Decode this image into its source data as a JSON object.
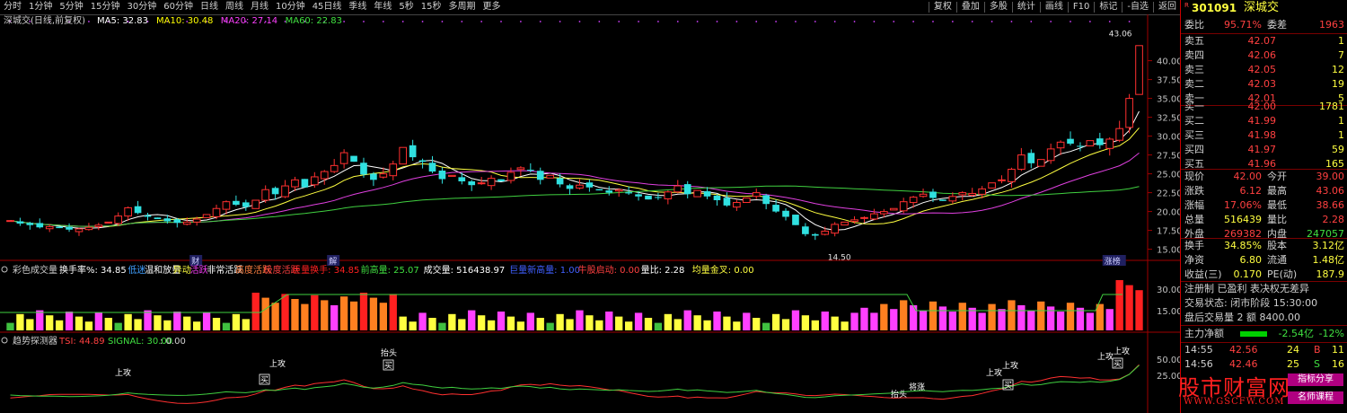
{
  "toolbar": {
    "periods": [
      "分时",
      "1分钟",
      "5分钟",
      "15分钟",
      "30分钟",
      "60分钟",
      "日线",
      "周线",
      "月线",
      "10分钟",
      "45日线",
      "季线",
      "年线",
      "5秒",
      "15秒",
      "多周期",
      "更多"
    ],
    "actions": [
      "复权",
      "叠加",
      "多股",
      "统计",
      "画线",
      "F10",
      "标记",
      "-自选",
      "返回"
    ]
  },
  "main_chart": {
    "title": "深城交(日线,前复权)",
    "ma": [
      {
        "label": "MA5: 32.83",
        "color": "#ffffff"
      },
      {
        "label": "MA10: 30.48",
        "color": "#ffff00"
      },
      {
        "label": "MA20: 27.14",
        "color": "#ff40ff"
      },
      {
        "label": "MA60: 22.83",
        "color": "#40e040"
      }
    ],
    "y_ticks": [
      "40.00",
      "37.50",
      "35.00",
      "32.50",
      "30.00",
      "27.50",
      "25.00",
      "22.50",
      "20.00",
      "17.50",
      "15.00"
    ],
    "high_label": "43.06",
    "low_label": "14.50",
    "event_labels": [
      "财",
      "解",
      "涨榜"
    ]
  },
  "volume_panel": {
    "title": "彩色成交量",
    "items": [
      {
        "label": "换手率%: 34.85",
        "color": "#ffffff"
      },
      {
        "label": "低迷",
        "color": "#40a0ff"
      },
      {
        "label": "温和放量",
        "color": "#ffffff"
      },
      {
        "label": "异动",
        "color": "#ffff40"
      },
      {
        "label": "活跃",
        "color": "#ff40ff"
      },
      {
        "label": "非常活跃",
        "color": "#ffffff"
      },
      {
        "label": "高度活跃",
        "color": "#ff8040"
      },
      {
        "label": "极度活跃",
        "color": "#ff4040"
      },
      {
        "label": "巨量换手: 34.85",
        "color": "#ff2020"
      },
      {
        "label": "前高量: 25.07",
        "color": "#40e040"
      },
      {
        "label": "成交量: 516438.97",
        "color": "#ffffff"
      },
      {
        "label": "巨量新高量: 1.00",
        "color": "#4060ff"
      },
      {
        "label": "牛股启动: 0.00",
        "color": "#ff4040"
      },
      {
        "label": "量比: 2.28",
        "color": "#ffffff"
      },
      {
        "label": "均量金叉: 0.00",
        "color": "#ffff40"
      }
    ],
    "y_ticks": [
      "30.00",
      "15.00"
    ]
  },
  "trend_panel": {
    "title": "趋势探测器",
    "tsi": "TSI: 44.89",
    "signal": "SIGNAL: 30.00",
    "extra": ": 0.00",
    "y_ticks": [
      "50.00",
      "25.00"
    ],
    "signals": [
      "上攻",
      "上攻",
      "抬头",
      "买",
      "买",
      "抬头",
      "将涨",
      "上攻",
      "上攻",
      "买",
      "上攻",
      "买",
      "上攻"
    ]
  },
  "quote": {
    "code": "301091",
    "name": "深城交",
    "weibi_label": "委比",
    "weibi": "95.71%",
    "weicha_label": "委差",
    "weicha": "1963",
    "asks": [
      {
        "label": "卖五",
        "price": "42.07",
        "vol": "1"
      },
      {
        "label": "卖四",
        "price": "42.06",
        "vol": "7"
      },
      {
        "label": "卖三",
        "price": "42.05",
        "vol": "12"
      },
      {
        "label": "卖二",
        "price": "42.03",
        "vol": "19"
      },
      {
        "label": "卖一",
        "price": "42.01",
        "vol": "5"
      }
    ],
    "bids": [
      {
        "label": "买一",
        "price": "42.00",
        "vol": "1781"
      },
      {
        "label": "买二",
        "price": "41.99",
        "vol": "1"
      },
      {
        "label": "买三",
        "price": "41.98",
        "vol": "1"
      },
      {
        "label": "买四",
        "price": "41.97",
        "vol": "59"
      },
      {
        "label": "买五",
        "price": "41.96",
        "vol": "165"
      }
    ],
    "stats": [
      {
        "l1": "现价",
        "v1": "42.00",
        "c1": "red",
        "l2": "今开",
        "v2": "39.00",
        "c2": "red"
      },
      {
        "l1": "涨跌",
        "v1": "6.12",
        "c1": "red",
        "l2": "最高",
        "v2": "43.06",
        "c2": "red"
      },
      {
        "l1": "涨幅",
        "v1": "17.06%",
        "c1": "red",
        "l2": "最低",
        "v2": "38.66",
        "c2": "red"
      },
      {
        "l1": "总量",
        "v1": "516439",
        "c1": "yellow",
        "l2": "量比",
        "v2": "2.28",
        "c2": "red"
      },
      {
        "l1": "外盘",
        "v1": "269382",
        "c1": "red",
        "l2": "内盘",
        "v2": "247057",
        "c2": "green"
      }
    ],
    "stats2": [
      {
        "l1": "换手",
        "v1": "34.85%",
        "c1": "yellow",
        "l2": "股本",
        "v2": "3.12亿",
        "c2": "yellow"
      },
      {
        "l1": "净资",
        "v1": "6.80",
        "c1": "yellow",
        "l2": "流通",
        "v2": "1.48亿",
        "c2": "yellow"
      },
      {
        "l1": "收益(三)",
        "v1": "0.170",
        "c1": "yellow",
        "l2": "PE(动)",
        "v2": "187.9",
        "c2": "yellow"
      }
    ],
    "notes": [
      "注册制 已盈利 表决权无差异",
      "交易状态: 闭市阶段 15:30:00",
      "盘后交易量 2 额 8400.00"
    ],
    "main_flow_label": "主力净额",
    "main_flow": "-2.54亿",
    "main_flow_pct": "-12%",
    "ticks": [
      {
        "time": "14:55",
        "price": "42.56",
        "vol": "24",
        "bs": "B",
        "n": "11"
      },
      {
        "time": "14:56",
        "price": "42.46",
        "vol": "25",
        "bs": "S",
        "n": "16"
      }
    ]
  },
  "watermark": {
    "title": "股市财富网",
    "url": "WWW.GSCFW.COM",
    "tag1": "指标分享",
    "tag2": "名师课程"
  },
  "chart_data": {
    "type": "candlestick",
    "ylim": [
      14,
      44
    ],
    "ma_labels": [
      "MA5",
      "MA10",
      "MA20",
      "MA60"
    ],
    "closes": [
      18.8,
      18.4,
      18.2,
      17.9,
      18.0,
      17.8,
      17.6,
      17.7,
      17.9,
      18.2,
      18.6,
      19.4,
      20.5,
      19.8,
      19.3,
      19.0,
      18.7,
      18.5,
      18.6,
      19.0,
      19.6,
      20.4,
      21.3,
      20.9,
      20.6,
      21.5,
      22.9,
      22.3,
      23.4,
      24.2,
      23.2,
      24.6,
      25.3,
      26.1,
      27.8,
      26.6,
      24.9,
      24.2,
      25.0,
      26.3,
      28.5,
      27.2,
      26.6,
      25.3,
      24.3,
      24.8,
      24.0,
      23.5,
      23.8,
      24.4,
      24.0,
      25.2,
      25.8,
      25.4,
      24.2,
      24.8,
      23.6,
      23.0,
      23.5,
      23.2,
      22.8,
      22.5,
      22.9,
      22.4,
      22.0,
      21.6,
      21.9,
      22.6,
      23.4,
      22.3,
      22.8,
      22.0,
      21.5,
      20.8,
      21.2,
      21.8,
      22.5,
      21.0,
      20.0,
      19.3,
      18.2,
      17.0,
      16.8,
      17.4,
      18.3,
      18.6,
      18.9,
      19.2,
      19.7,
      20.0,
      20.4,
      21.3,
      21.9,
      22.3,
      21.8,
      21.4,
      22.0,
      22.5,
      22.4,
      23.0,
      23.8,
      24.2,
      25.6,
      27.5,
      26.4,
      26.9,
      28.3,
      29.2,
      29.0,
      28.7,
      29.4,
      28.8,
      29.6,
      31.0,
      35.0,
      42.0
    ]
  }
}
